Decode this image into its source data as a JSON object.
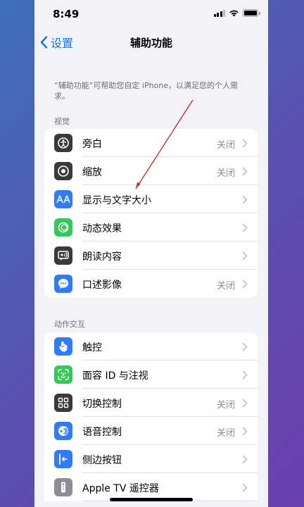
{
  "status": {
    "time": "8:49"
  },
  "nav": {
    "back_label": "设置",
    "title": "辅助功能"
  },
  "intro": "“辅助功能”可帮助您自定 iPhone，以满足您的个人需求。",
  "sections": [
    {
      "header": "视觉",
      "items": [
        {
          "label": "旁白",
          "value": "关闭",
          "icon": "voiceover-icon",
          "color": "#3a3a3c"
        },
        {
          "label": "缩放",
          "value": "关闭",
          "icon": "zoom-icon",
          "color": "#3a3a3c"
        },
        {
          "label": "显示与文字大小",
          "value": "",
          "icon": "text-size-icon",
          "color": "#2f7cf6"
        },
        {
          "label": "动态效果",
          "value": "",
          "icon": "motion-icon",
          "color": "#34c759"
        },
        {
          "label": "朗读内容",
          "value": "",
          "icon": "spoken-content-icon",
          "color": "#3a3a3c"
        },
        {
          "label": "口述影像",
          "value": "关闭",
          "icon": "audio-description-icon",
          "color": "#2f7cf6"
        }
      ]
    },
    {
      "header": "动作交互",
      "items": [
        {
          "label": "触控",
          "value": "",
          "icon": "touch-icon",
          "color": "#2f7cf6"
        },
        {
          "label": "面容 ID 与注视",
          "value": "",
          "icon": "face-id-icon",
          "color": "#34c759"
        },
        {
          "label": "切换控制",
          "value": "关闭",
          "icon": "switch-control-icon",
          "color": "#3a3a3c"
        },
        {
          "label": "语音控制",
          "value": "关闭",
          "icon": "voice-control-icon",
          "color": "#2f7cf6"
        },
        {
          "label": "侧边按钮",
          "value": "",
          "icon": "side-button-icon",
          "color": "#2f7cf6"
        },
        {
          "label": "Apple TV 遥控器",
          "value": "",
          "icon": "apple-tv-remote-icon",
          "color": "#8e8e93"
        }
      ]
    }
  ]
}
